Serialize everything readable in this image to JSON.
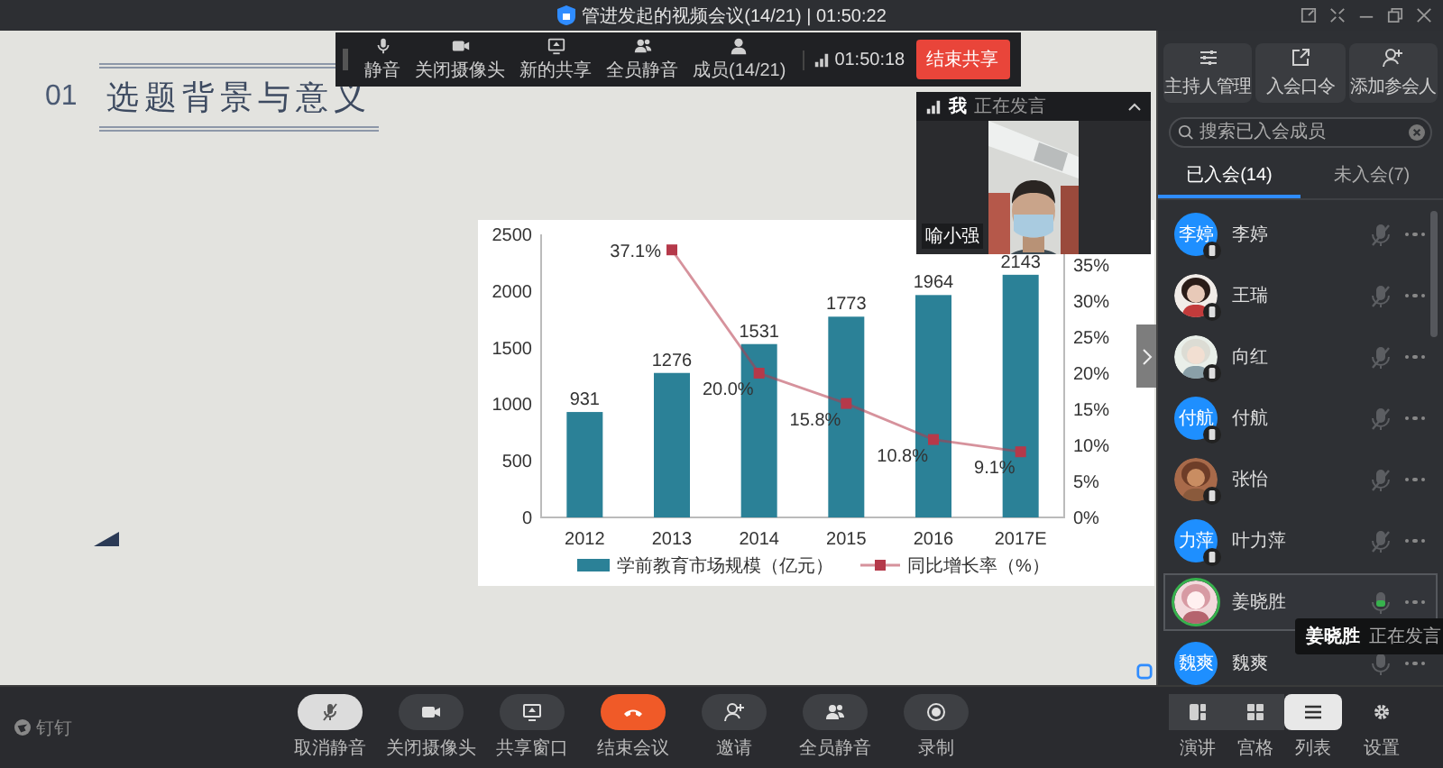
{
  "window": {
    "title": "管进发起的视频会议(14/21) | 01:50:22"
  },
  "share_toolbar": {
    "items": [
      {
        "label": "静音",
        "kind": "mic"
      },
      {
        "label": "关闭摄像头",
        "kind": "camera"
      },
      {
        "label": "新的共享",
        "kind": "share"
      },
      {
        "label": "全员静音",
        "kind": "mute_all"
      },
      {
        "label": "成员(14/21)",
        "kind": "members"
      }
    ],
    "timer": "01:50:18",
    "end_button": "结束共享"
  },
  "slide": {
    "number": "01",
    "title": "选题背景与意义",
    "chart_data": {
      "type": "bar",
      "categories": [
        "2012",
        "2013",
        "2014",
        "2015",
        "2016",
        "2017E"
      ],
      "series": [
        {
          "name": "学前教育市场规模（亿元）",
          "color": "#2b8197",
          "values": [
            931,
            1276,
            1531,
            1773,
            1964,
            2143
          ]
        },
        {
          "name": "同比增长率（%）",
          "color": "#b5394a",
          "type": "line",
          "axis": "y2",
          "marker": "square",
          "values": [
            null,
            37.1,
            20.0,
            15.8,
            10.8,
            9.1
          ],
          "value_labels": [
            null,
            "37.1%",
            "20.0%",
            "15.8%",
            "10.8%",
            "9.1%"
          ]
        }
      ],
      "ylim": [
        0,
        2500
      ],
      "yticks": [
        0,
        500,
        1000,
        1500,
        2000,
        2500
      ],
      "y2lim": [
        0,
        39.25
      ],
      "y2ticks": [
        {
          "value": 0,
          "label": "0%"
        },
        {
          "value": 5,
          "label": "5%"
        },
        {
          "value": 10,
          "label": "10%"
        },
        {
          "value": 15,
          "label": "15%"
        },
        {
          "value": 20,
          "label": "20%"
        },
        {
          "value": 25,
          "label": "25%"
        },
        {
          "value": 30,
          "label": "30%"
        },
        {
          "value": 35,
          "label": "35%"
        }
      ],
      "data_labels": true,
      "legend": "bottom"
    }
  },
  "video_tile": {
    "speaker": "我",
    "status": "正在发言",
    "name": "喻小强"
  },
  "panel": {
    "buttons": [
      {
        "label": "主持人管理",
        "kind": "host"
      },
      {
        "label": "入会口令",
        "kind": "passcode"
      },
      {
        "label": "添加参会人",
        "kind": "add"
      }
    ],
    "search": {
      "placeholder": "搜索已入会成员"
    },
    "tabs": [
      {
        "label": "已入会(14)",
        "selected": true
      },
      {
        "label": "未入会(7)",
        "selected": false
      }
    ],
    "members": [
      {
        "name": "李婷",
        "kind": "text",
        "avatar_text": "李婷",
        "mobile": true,
        "muted": true,
        "speaking": false
      },
      {
        "name": "王瑞",
        "kind": "picture",
        "mobile": true,
        "muted": true,
        "speaking": false
      },
      {
        "name": "向红",
        "kind": "picture",
        "mobile": true,
        "muted": true,
        "speaking": false
      },
      {
        "name": "付航",
        "kind": "text",
        "avatar_text": "付航",
        "mobile": true,
        "muted": true,
        "speaking": false
      },
      {
        "name": "张怡",
        "kind": "picture",
        "mobile": true,
        "muted": true,
        "speaking": false
      },
      {
        "name": "叶力萍",
        "kind": "text",
        "avatar_text": "力萍",
        "mobile": true,
        "muted": true,
        "speaking": false
      },
      {
        "name": "姜晓胜",
        "kind": "picture",
        "mobile": false,
        "muted": false,
        "speaking": true
      },
      {
        "name": "魏爽",
        "kind": "text",
        "avatar_text": "魏爽",
        "mobile": false,
        "muted": false,
        "speaking": false
      }
    ],
    "tooltip": {
      "name": "姜晓胜",
      "status": "正在发言"
    }
  },
  "toolbar": {
    "logo": "钉钉",
    "buttons": [
      {
        "label": "取消静音",
        "kind": "unmute",
        "active": true
      },
      {
        "label": "关闭摄像头",
        "kind": "camera",
        "active": false
      },
      {
        "label": "共享窗口",
        "kind": "share",
        "active": false
      },
      {
        "label": "结束会议",
        "kind": "end",
        "active": false
      },
      {
        "label": "邀请",
        "kind": "invite",
        "active": false
      },
      {
        "label": "全员静音",
        "kind": "mute_all",
        "active": false
      },
      {
        "label": "录制",
        "kind": "record",
        "active": false
      }
    ]
  },
  "views": [
    {
      "label": "演讲",
      "kind": "speaker",
      "selected": false
    },
    {
      "label": "宫格",
      "kind": "grid",
      "selected": false
    },
    {
      "label": "列表",
      "kind": "list",
      "selected": true
    }
  ],
  "settings": {
    "label": "设置",
    "kind": "settings"
  }
}
